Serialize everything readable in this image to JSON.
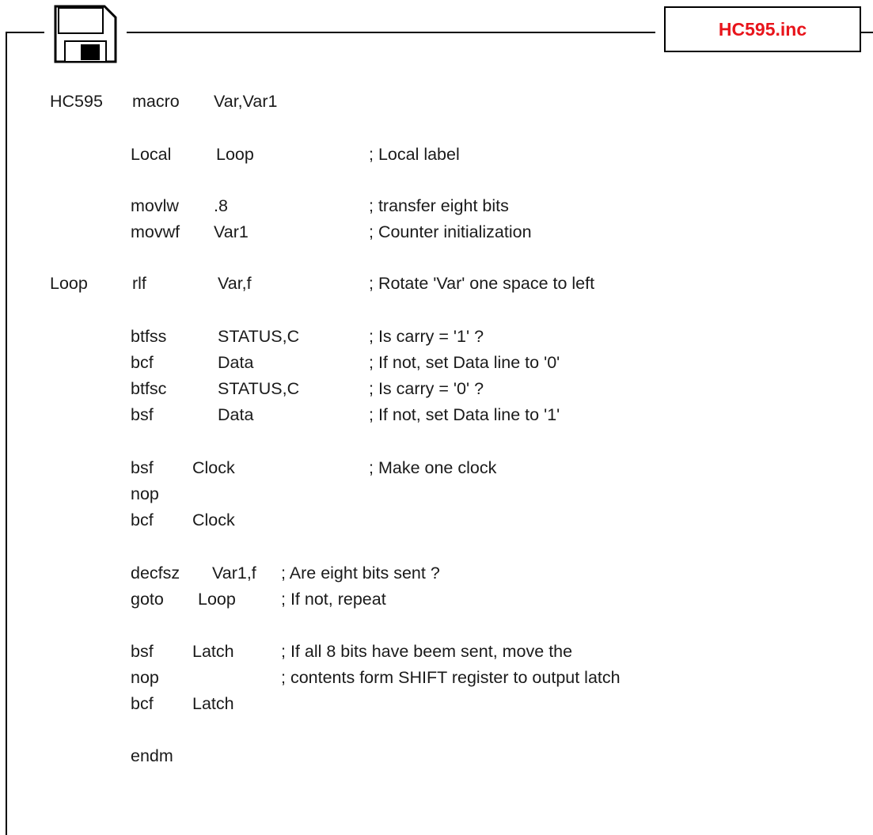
{
  "file_tab": {
    "name": "HC595.inc",
    "color": "#e8141b"
  },
  "icons": {
    "save": "floppy-disk-icon"
  },
  "code": {
    "macro_decl": {
      "label": "HC595",
      "instr": "macro",
      "args": "Var,Var1"
    },
    "local": {
      "instr": "Local",
      "args": "Loop",
      "comment": "; Local label"
    },
    "movlw": {
      "instr": "movlw",
      "args": ".8",
      "comment": "; transfer eight bits"
    },
    "movwf": {
      "instr": "movwf",
      "args": "Var1",
      "comment": "; Counter initialization"
    },
    "rlf": {
      "label": "Loop",
      "instr": "rlf",
      "args": "Var,f",
      "comment": "; Rotate 'Var' one space to left"
    },
    "btfss": {
      "instr": "btfss",
      "args": "STATUS,C",
      "comment": "; Is carry = '1' ?"
    },
    "bcf_data": {
      "instr": "bcf",
      "args": "Data",
      "comment": "; If not, set Data line to '0'"
    },
    "btfsc": {
      "instr": "btfsc",
      "args": "STATUS,C",
      "comment": "; Is carry = '0' ?"
    },
    "bsf_data": {
      "instr": "bsf",
      "args": "Data",
      "comment": "; If not, set Data line to '1'"
    },
    "bsf_clock": {
      "instr": "bsf",
      "args": "Clock",
      "comment": "; Make one clock"
    },
    "nop_1": {
      "instr": "nop"
    },
    "bcf_clock": {
      "instr": "bcf",
      "args": "Clock"
    },
    "decfsz": {
      "instr": "decfsz",
      "args": "Var1,f",
      "comment": "; Are eight bits sent ?"
    },
    "goto": {
      "instr": "goto",
      "args": "Loop",
      "comment": "; If not, repeat"
    },
    "bsf_latch": {
      "instr": "bsf",
      "args": "Latch",
      "comment": "; If all 8 bits have beem sent, move the"
    },
    "nop_2": {
      "instr": "nop",
      "comment": "; contents form SHIFT register to output latch"
    },
    "bcf_latch": {
      "instr": "bcf",
      "args": "Latch"
    },
    "endm": {
      "instr": "endm"
    }
  }
}
